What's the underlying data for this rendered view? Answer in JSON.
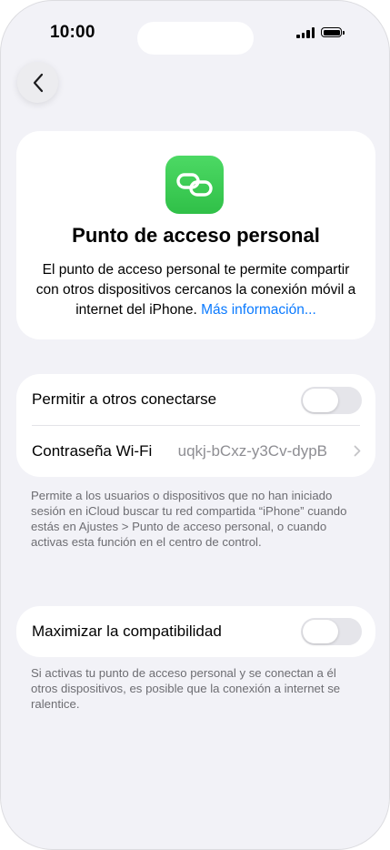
{
  "status_bar": {
    "time": "10:00"
  },
  "icons": {
    "back": "chevron-left-icon",
    "hotspot": "link-chain-icon",
    "disclosure": "chevron-right-icon"
  },
  "colors": {
    "accent_link": "#0a7aff",
    "hotspot_green": "#34c759",
    "background": "#f2f2f7"
  },
  "hero": {
    "title": "Punto de acceso personal",
    "description": "El punto de acceso personal te permite compartir con otros dispositivos cercanos la conexión móvil a internet del iPhone.",
    "link": "Más información..."
  },
  "sharing": {
    "allow_others_label": "Permitir a otros conectarse",
    "allow_others_on": false,
    "wifi_password_label": "Contraseña Wi‑Fi",
    "wifi_password_value": "uqkj-bCxz-y3Cv-dypB",
    "footnote": "Permite a los usuarios o dispositivos que no han iniciado sesión en iCloud buscar tu red compartida “iPhone” cuando estás en Ajustes > Punto de acceso personal, o cuando activas esta función en el centro de control."
  },
  "compatibility": {
    "label": "Maximizar la compatibilidad",
    "on": false,
    "footnote": "Si activas tu punto de acceso personal y se conectan a él otros dispositivos, es posible que la conexión a internet se ralentice."
  }
}
